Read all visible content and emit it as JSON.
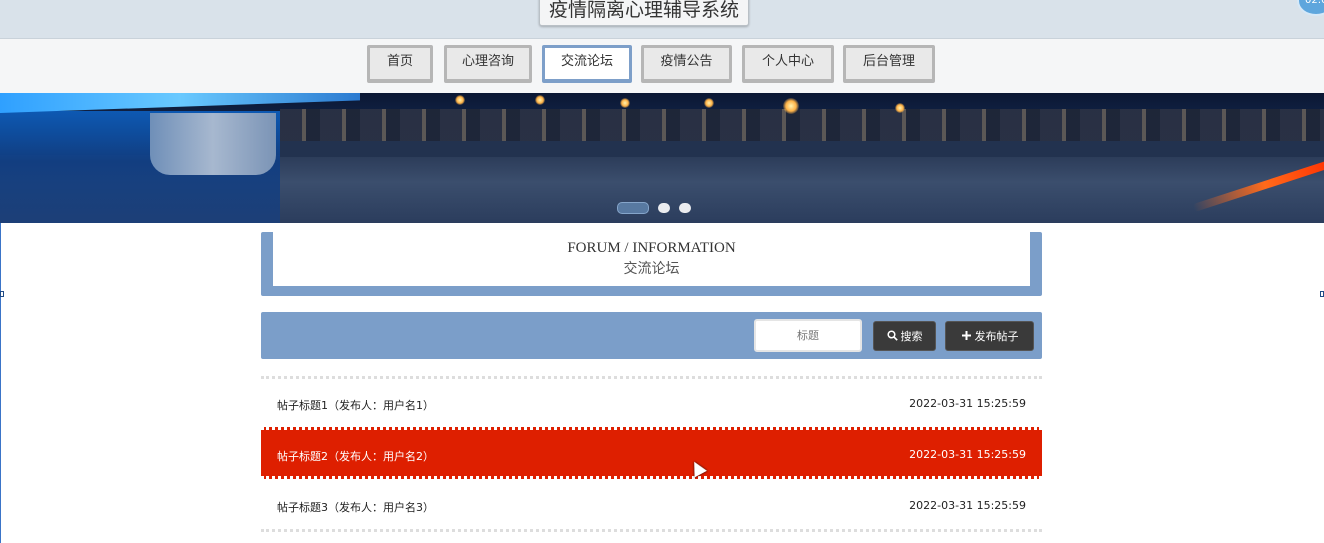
{
  "app": {
    "title": "疫情隔离心理辅导系统",
    "corner_badge": "02:0"
  },
  "nav": {
    "items": [
      {
        "label": "首页",
        "active": false
      },
      {
        "label": "心理咨询",
        "active": false
      },
      {
        "label": "交流论坛",
        "active": true
      },
      {
        "label": "疫情公告",
        "active": false
      },
      {
        "label": "个人中心",
        "active": false
      },
      {
        "label": "后台管理",
        "active": false
      }
    ]
  },
  "banner": {
    "slides_total": 3,
    "active_slide": 1
  },
  "section": {
    "title_en": "FORUM / INFORMATION",
    "title_zh": "交流论坛"
  },
  "search": {
    "placeholder": "标题",
    "search_label": "搜索",
    "publish_label": "发布帖子",
    "search_icon": "magnifier-icon",
    "publish_icon": "plus-icon"
  },
  "posts": [
    {
      "title": "帖子标题1（发布人：用户名1）",
      "time": "2022-03-31 15:25:59",
      "highlighted": false
    },
    {
      "title": "帖子标题2（发布人：用户名2）",
      "time": "2022-03-31 15:25:59",
      "highlighted": true
    },
    {
      "title": "帖子标题3（发布人：用户名3）",
      "time": "2022-03-31 15:25:59",
      "highlighted": false
    }
  ],
  "colors": {
    "accent": "#7b9ec9",
    "highlight_row": "#de1f00",
    "button_dark": "#3a3a3a"
  }
}
